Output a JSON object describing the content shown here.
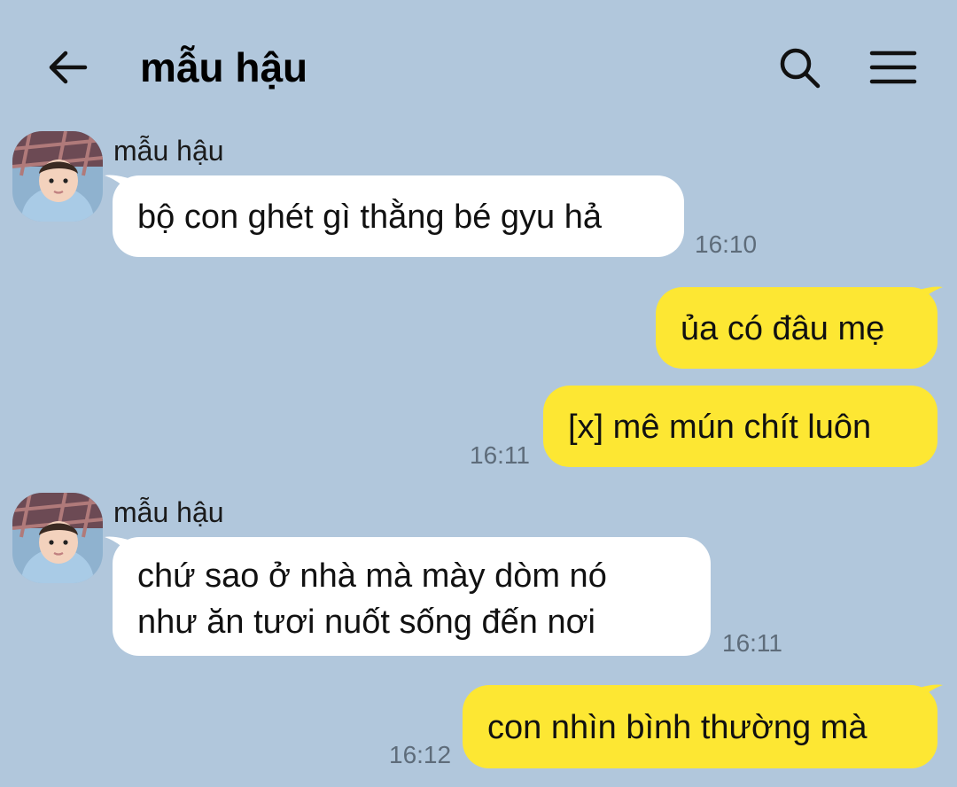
{
  "header": {
    "title": "mẫu hậu",
    "back_icon": "arrow-left-icon",
    "search_icon": "search-icon",
    "menu_icon": "menu-icon"
  },
  "colors": {
    "background": "#b1c7dc",
    "incoming_bubble": "#ffffff",
    "outgoing_bubble": "#fde733"
  },
  "messages": [
    {
      "direction": "incoming",
      "sender": "mẫu hậu",
      "text": "bộ con ghét gì thằng bé gyu hả",
      "time": "16:10"
    },
    {
      "direction": "outgoing",
      "text": "ủa có đâu mẹ"
    },
    {
      "direction": "outgoing",
      "text": "[x] mê mún chít luôn",
      "time": "16:11"
    },
    {
      "direction": "incoming",
      "sender": "mẫu hậu",
      "lines": [
        "chứ sao ở nhà mà mày dòm nó",
        "như ăn tươi nuốt sống đến nơi"
      ],
      "time": "16:11"
    },
    {
      "direction": "outgoing",
      "text": "con nhìn bình thường mà",
      "time": "16:12"
    }
  ]
}
